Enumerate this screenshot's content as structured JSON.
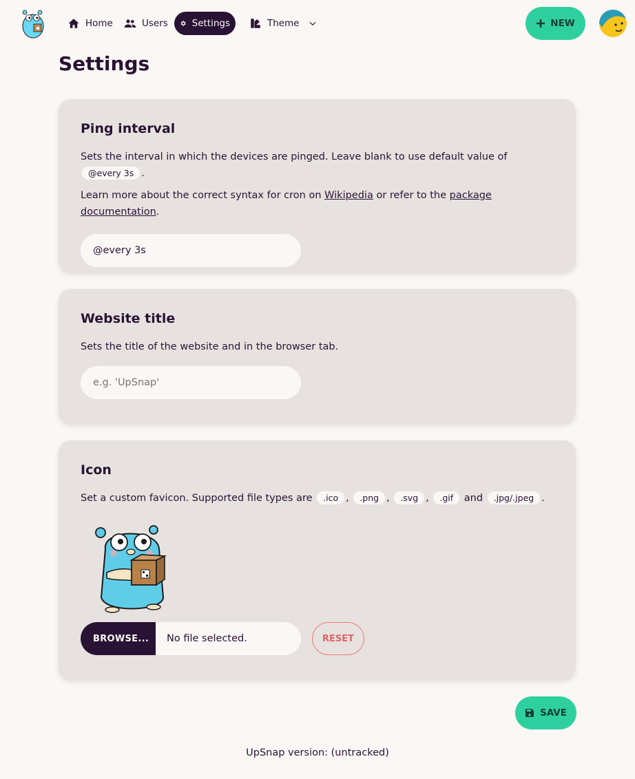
{
  "nav": {
    "items": [
      {
        "label": "Home",
        "icon": "home-icon"
      },
      {
        "label": "Users",
        "icon": "users-icon"
      },
      {
        "label": "Settings",
        "icon": "gear-icon",
        "active": true
      },
      {
        "label": "Theme",
        "icon": "palette-icon"
      }
    ],
    "new_label": "NEW"
  },
  "page": {
    "title": "Settings"
  },
  "ping": {
    "title": "Ping interval",
    "desc_before": "Sets the interval in which the devices are pinged. Leave blank to use default value of",
    "default_code": "@every 3s",
    "desc_after": ".",
    "learn_before": "Learn more about the correct syntax for cron on",
    "wiki_link": "Wikipedia",
    "learn_middle": "or refer to the",
    "doc_link": "package documentation",
    "learn_after": ".",
    "value": "@every 3s"
  },
  "website_title": {
    "title": "Website title",
    "desc": "Sets the title of the website and in the browser tab.",
    "placeholder": "e.g. 'UpSnap'"
  },
  "icon_section": {
    "title": "Icon",
    "desc_before": "Set a custom favicon. Supported file types are",
    "types": [
      ".ico",
      ".png",
      ".svg",
      ".gif"
    ],
    "and_word": "and",
    "last_type": ".jpg/.jpeg",
    "browse_label": "BROWSE...",
    "file_status": "No file selected.",
    "reset_label": "RESET"
  },
  "save_label": "SAVE",
  "footer": "UpSnap version: (untracked)",
  "colors": {
    "accent": "#2fd09f",
    "primary": "#291334",
    "card": "#e7e2df",
    "background": "#faf7f5",
    "danger": "#e06767"
  }
}
